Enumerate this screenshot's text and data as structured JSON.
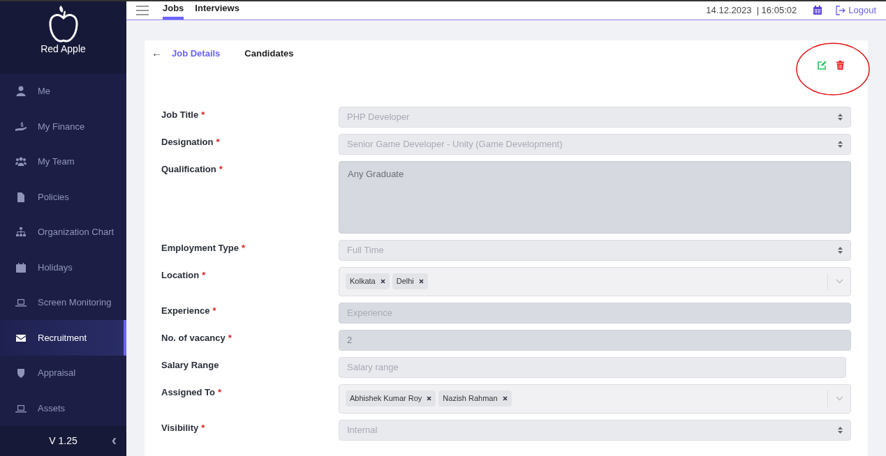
{
  "sidebar": {
    "brand": "Red Apple",
    "items": [
      {
        "label": "Me",
        "selected": false
      },
      {
        "label": "My Finance",
        "selected": false
      },
      {
        "label": "My Team",
        "selected": false
      },
      {
        "label": "Policies",
        "selected": false
      },
      {
        "label": "Organization Chart",
        "selected": false
      },
      {
        "label": "Holidays",
        "selected": false
      },
      {
        "label": "Screen Monitoring",
        "selected": false
      },
      {
        "label": "Recruitment",
        "selected": true
      },
      {
        "label": "Appraisal",
        "selected": false
      },
      {
        "label": "Assets",
        "selected": false
      }
    ],
    "version": "V 1.25",
    "collapse": "‹"
  },
  "topbar": {
    "tabs": [
      {
        "label": "Jobs",
        "selected": true
      },
      {
        "label": "Interviews",
        "selected": false
      }
    ],
    "datetime": "14.12.2023  | 16:05:02",
    "logout": "Logout"
  },
  "card": {
    "back": "←",
    "tabs": [
      {
        "label": "Job Details",
        "selected": true
      },
      {
        "label": "Candidates",
        "selected": false
      }
    ],
    "fields": [
      {
        "kind": "select",
        "label": "Job Title",
        "required_mark": "*",
        "value": "PHP Developer"
      },
      {
        "kind": "select",
        "label": "Designation",
        "required_mark": "*",
        "value": "Senior Game Developer - Unity (Game Development)"
      },
      {
        "kind": "textarea",
        "label": "Qualification",
        "required_mark": "*",
        "value": "Any Graduate"
      },
      {
        "kind": "select",
        "label": "Employment Type",
        "required_mark": "*",
        "value": "Full Time"
      },
      {
        "kind": "tags",
        "label": "Location",
        "required_mark": "*",
        "tags": [
          "Kolkata",
          "Delhi"
        ]
      },
      {
        "kind": "input",
        "label": "Experience",
        "required_mark": "*",
        "placeholder": "Experience",
        "disabled": true
      },
      {
        "kind": "input",
        "label": "No. of vacancy",
        "required_mark": "*",
        "value": "2",
        "disabled": true
      },
      {
        "kind": "input",
        "label": "Salary Range",
        "placeholder": "Salary range",
        "disabled": false
      },
      {
        "kind": "tags",
        "label": "Assigned To",
        "required_mark": "*",
        "tags": [
          "Abhishek Kumar Roy",
          "Nazish Rahman"
        ]
      },
      {
        "kind": "select",
        "label": "Visibility",
        "required_mark": "*",
        "value": "Internal"
      }
    ]
  }
}
